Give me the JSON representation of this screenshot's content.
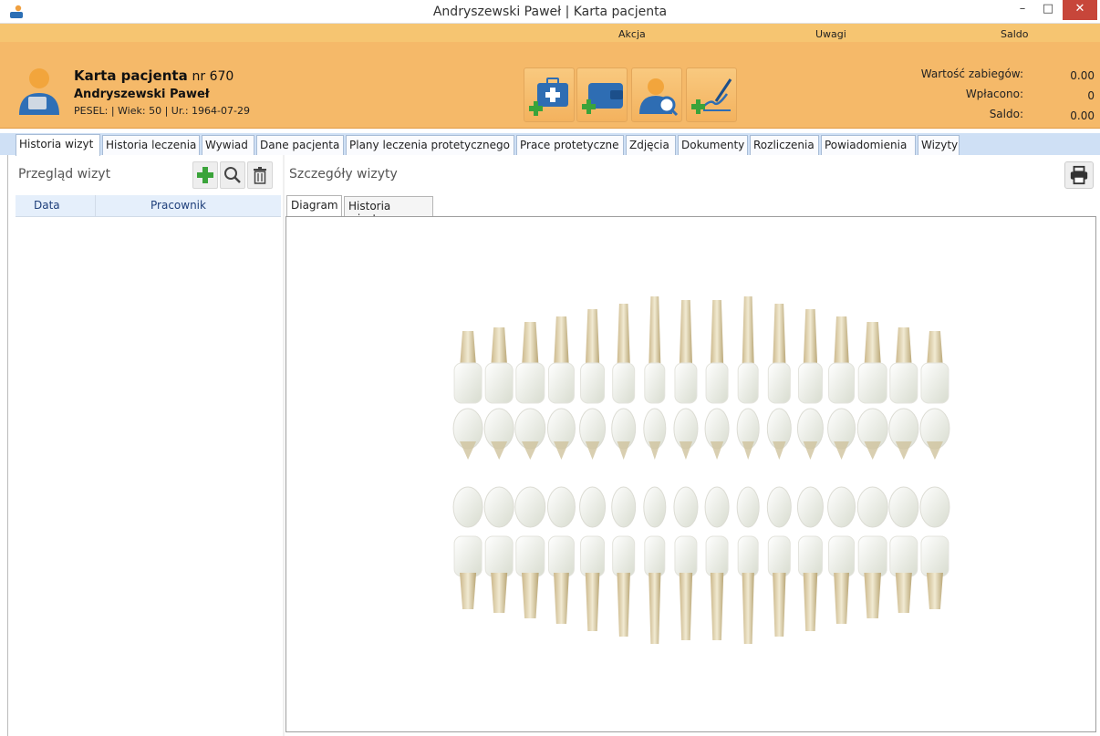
{
  "window": {
    "title": "Andryszewski Paweł | Karta pacjenta",
    "minimize": "–",
    "maximize": "□",
    "close": "✕"
  },
  "header": {
    "column_headers": {
      "akcja": "Akcja",
      "uwagi": "Uwagi",
      "saldo": "Saldo"
    },
    "card_title": "Karta pacjenta",
    "card_number": "nr 670",
    "patient_name": "Andryszewski Paweł",
    "patient_meta": "PESEL:  | Wiek: 50  | Ur.: 1964-07-29",
    "summary": [
      {
        "label": "Wartość zabiegów:",
        "value": "0.00"
      },
      {
        "label": "Wpłacono:",
        "value": "0"
      },
      {
        "label": "Saldo:",
        "value": "0.00"
      }
    ],
    "action_icons": [
      "medical-kit-add-icon",
      "wallet-add-icon",
      "user-search-icon",
      "signature-add-icon"
    ]
  },
  "tabs": [
    "Historia wizyt",
    "Historia leczenia",
    "Wywiad",
    "Dane pacjenta",
    "Plany leczenia protetycznego",
    "Prace protetyczne",
    "Zdjęcia",
    "Dokumenty",
    "Rozliczenia",
    "Powiadomienia",
    "Wizyty"
  ],
  "left_panel": {
    "title": "Przegląd wizyt",
    "columns": [
      "Data",
      "Pracownik"
    ]
  },
  "right_panel": {
    "title": "Szczegóły wizyty",
    "subtabs": [
      "Diagram",
      "Historia wizyty"
    ]
  },
  "colors": {
    "header_orange": "#f5b969",
    "tab_bar_blue": "#cfe0f5",
    "close_red": "#c7463a",
    "add_green": "#3aa33a"
  }
}
